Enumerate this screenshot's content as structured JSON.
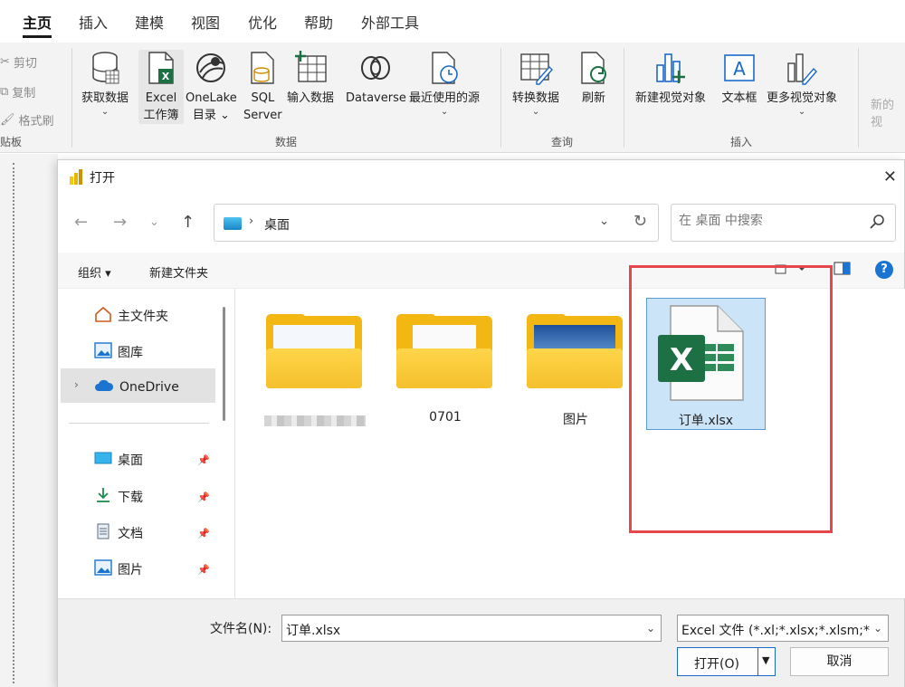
{
  "tabs": [
    "主页",
    "插入",
    "建模",
    "视图",
    "优化",
    "帮助",
    "外部工具"
  ],
  "ribbon": {
    "clipboard": {
      "cut": "剪切",
      "copy": "复制",
      "format_painter": "格式刷",
      "group": "贴板"
    },
    "data_buttons": {
      "get_data": "获取数据",
      "excel_l1": "Excel",
      "excel_l2": "工作簿",
      "onelake_l1": "OneLake",
      "onelake_l2": "目录",
      "sql_l1": "SQL",
      "sql_l2": "Server",
      "enter_data": "输入数据",
      "dataverse": "Dataverse",
      "recent": "最近使用的源"
    },
    "data_group": "数据",
    "query": {
      "transform": "转换数据",
      "refresh": "刷新",
      "group": "查询"
    },
    "insert": {
      "new_visual": "新建视觉对象",
      "textbox": "文本框",
      "more_visuals": "更多视觉对象",
      "group": "插入"
    },
    "cut_off": "新的视"
  },
  "dialog": {
    "title": "打开",
    "address": {
      "crumb": "桌面"
    },
    "search": {
      "placeholder": "在 桌面 中搜索"
    },
    "toolbar": {
      "organize": "组织",
      "new_folder": "新建文件夹",
      "help": "?"
    },
    "nav": {
      "home": "主文件夹",
      "gallery": "图库",
      "onedrive": "OneDrive",
      "desktop": "桌面",
      "downloads": "下载",
      "documents": "文档",
      "pictures": "图片"
    },
    "items": [
      {
        "name": "",
        "type": "folder"
      },
      {
        "name": "0701",
        "type": "folder"
      },
      {
        "name": "图片",
        "type": "folder"
      },
      {
        "name": "订单.xlsx",
        "type": "excel"
      }
    ],
    "footer": {
      "filename_label": "文件名(N):",
      "filename_value": "订单.xlsx",
      "filetype_value": "Excel 文件 (*.xl;*.xlsx;*.xlsm;*.",
      "open": "打开(O)",
      "cancel": "取消"
    }
  },
  "colors": {
    "excel_green": "#1d7044",
    "highlight_red": "#e5474c",
    "accent_blue": "#1b6ac9",
    "folder_yellow": "#f3b714"
  }
}
